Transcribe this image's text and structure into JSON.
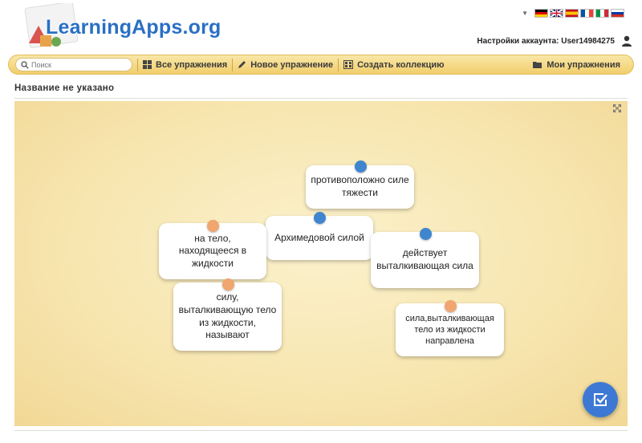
{
  "header": {
    "logo_text": "LearningApps.org",
    "account_label": "Настройки аккаунта: User14984275",
    "languages": [
      "de",
      "en",
      "es",
      "fr",
      "it",
      "ru"
    ]
  },
  "nav": {
    "search_placeholder": "Поиск",
    "all_exercises": "Все упражнения",
    "new_exercise": "Новое упражнение",
    "create_collection": "Создать коллекцию",
    "my_exercises": "Мои упражнения"
  },
  "page": {
    "title": "Название не указано"
  },
  "cards": [
    {
      "id": "card-opposite-gravity",
      "text": "противоположно силе тяжести",
      "pin": "blue"
    },
    {
      "id": "card-archimedes-force",
      "text": "Архимедовой силой",
      "pin": "blue"
    },
    {
      "id": "card-acting-buoyant-force",
      "text": "действует выталкивающая сила",
      "pin": "blue"
    },
    {
      "id": "card-on-body-in-liquid",
      "text": "на тело, находящееся в жидкости",
      "pin": "orange"
    },
    {
      "id": "card-force-pushing-out",
      "text": "силу, выталкивающую тело из жидкости, называют",
      "pin": "orange"
    },
    {
      "id": "card-buoyant-force-directed",
      "text": "сила,выталкивающая тело из жидкости направлена",
      "pin": "orange"
    }
  ],
  "colors": {
    "accent_blue": "#3f86cf",
    "accent_orange": "#f0a66e",
    "navbar": "#f1ce6c",
    "logo_blue": "#2a6fc4"
  },
  "icons": {
    "check_button": "check-square-icon",
    "fullscreen": "expand-icon",
    "account": "user-icon"
  }
}
